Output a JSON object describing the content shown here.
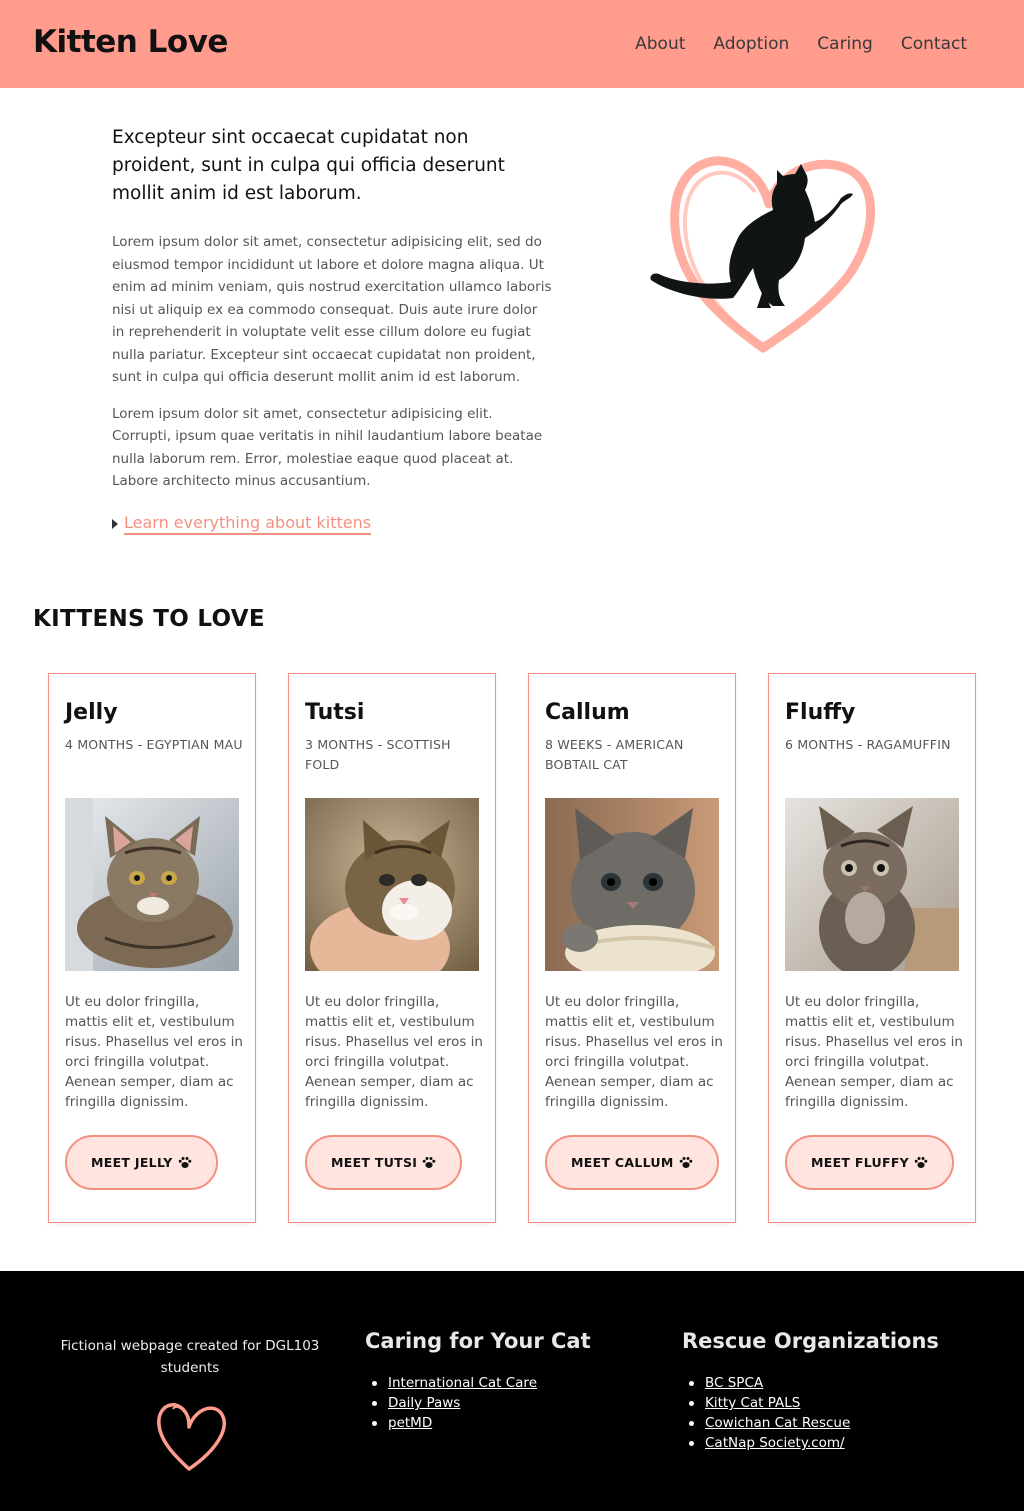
{
  "header": {
    "site_title": "Kitten Love",
    "nav": [
      "About",
      "Adoption",
      "Caring",
      "Contact"
    ]
  },
  "intro": {
    "lead": "Excepteur sint occaecat cupidatat non proident, sunt in culpa qui officia deserunt mollit anim id est laborum.",
    "paragraphs": [
      "Lorem ipsum dolor sit amet, consectetur adipisicing elit, sed do eiusmod tempor incididunt ut labore et dolore magna aliqua. Ut enim ad minim veniam, quis nostrud exercitation ullamco laboris nisi ut aliquip ex ea commodo consequat. Duis aute irure dolor in reprehenderit in voluptate velit esse cillum dolore eu fugiat nulla pariatur. Excepteur sint occaecat cupidatat non proident, sunt in culpa qui officia deserunt mollit anim id est laborum.",
      "Lorem ipsum dolor sit amet, consectetur adipisicing elit. Corrupti, ipsum quae veritatis in nihil laudantium labore beatae nulla laborum rem. Error, molestiae eaque quod placeat at. Labore architecto minus accusantium."
    ],
    "link_label": "Learn everything about kittens"
  },
  "kittens_section": {
    "title": "KITTENS TO LOVE",
    "cards": [
      {
        "name": "Jelly",
        "meta": "4 MONTHS - EGYPTIAN MAU",
        "description": "Ut eu dolor fringilla, mattis elit et, vestibulum risus. Phasellus vel eros in orci fringilla volutpat. Aenean semper, diam ac fringilla dignissim.",
        "button": "MEET JELLY"
      },
      {
        "name": "Tutsi",
        "meta": "3 MONTHS - SCOTTISH FOLD",
        "description": "Ut eu dolor fringilla, mattis elit et, vestibulum risus. Phasellus vel eros in orci fringilla volutpat. Aenean semper, diam ac fringilla dignissim.",
        "button": "MEET TUTSI"
      },
      {
        "name": "Callum",
        "meta": "8 WEEKS - AMERICAN BOBTAIL CAT",
        "description": "Ut eu dolor fringilla, mattis elit et, vestibulum risus. Phasellus vel eros in orci fringilla volutpat. Aenean semper, diam ac fringilla dignissim.",
        "button": "MEET CALLUM"
      },
      {
        "name": "Fluffy",
        "meta": "6 MONTHS - RAGAMUFFIN",
        "description": "Ut eu dolor fringilla, mattis elit et, vestibulum risus. Phasellus vel eros in orci fringilla volutpat. Aenean semper, diam ac fringilla dignissim.",
        "button": "MEET FLUFFY"
      }
    ]
  },
  "footer": {
    "note": "Fictional webpage created for DGL103 students",
    "caring": {
      "title": "Caring for Your Cat",
      "links": [
        "International Cat Care",
        "Daily Paws",
        "petMD"
      ]
    },
    "rescue": {
      "title": "Rescue Organizations",
      "links": [
        "BC SPCA",
        "Kitty Cat PALS",
        "Cowichan Cat Rescue",
        "CatNap Society.com/"
      ]
    }
  },
  "colors": {
    "header_bg": "#ff9c8e",
    "accent": "#f4907f",
    "button_bg": "#ffe4df",
    "footer_bg": "#000000"
  },
  "icons": {
    "hero": "cat-heart-illustration",
    "button": "paw-icon",
    "footer": "heart-icon",
    "caret": "caret-right-icon"
  }
}
